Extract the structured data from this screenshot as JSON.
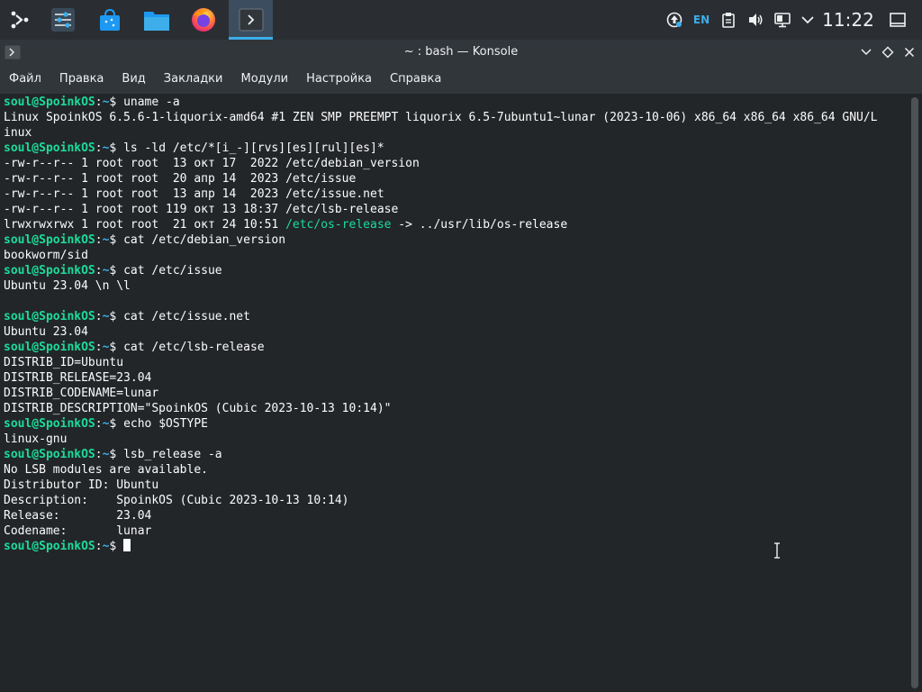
{
  "panel": {
    "launchers": [
      {
        "name": "application-launcher-icon"
      },
      {
        "name": "system-settings-icon"
      },
      {
        "name": "discover-store-icon"
      },
      {
        "name": "dolphin-file-manager-icon"
      },
      {
        "name": "firefox-icon"
      },
      {
        "name": "konsole-task-icon"
      }
    ],
    "tray": {
      "language": "EN",
      "clock": "11:22"
    }
  },
  "window": {
    "title": "~ : bash — Konsole"
  },
  "menu": [
    "Файл",
    "Правка",
    "Вид",
    "Закладки",
    "Модули",
    "Настройка",
    "Справка"
  ],
  "terminal": {
    "user_host": "soul@SpoinkOS",
    "path": "~",
    "lines": [
      {
        "type": "prompt",
        "cmd": "uname -a"
      },
      {
        "type": "out",
        "text": "Linux SpoinkOS 6.5.6-1-liquorix-amd64 #1 ZEN SMP PREEMPT liquorix 6.5-7ubuntu1~lunar (2023-10-06) x86_64 x86_64 x86_64 GNU/L"
      },
      {
        "type": "out",
        "text": "inux"
      },
      {
        "type": "prompt",
        "cmd": "ls -ld /etc/*[i_-][rvs][es][rul][es]*"
      },
      {
        "type": "out",
        "text": "-rw-r--r-- 1 root root  13 окт 17  2022 /etc/debian_version"
      },
      {
        "type": "out",
        "text": "-rw-r--r-- 1 root root  20 апр 14  2023 /etc/issue"
      },
      {
        "type": "out",
        "text": "-rw-r--r-- 1 root root  13 апр 14  2023 /etc/issue.net"
      },
      {
        "type": "out",
        "text": "-rw-r--r-- 1 root root 119 окт 13 18:37 /etc/lsb-release"
      },
      {
        "type": "link",
        "text": "lrwxrwxrwx 1 root root  21 окт 24 10:51 ",
        "link": "/etc/os-release",
        "rest": " -> ../usr/lib/os-release"
      },
      {
        "type": "prompt",
        "cmd": "cat /etc/debian_version"
      },
      {
        "type": "out",
        "text": "bookworm/sid"
      },
      {
        "type": "prompt",
        "cmd": "cat /etc/issue"
      },
      {
        "type": "out",
        "text": "Ubuntu 23.04 \\n \\l"
      },
      {
        "type": "out",
        "text": ""
      },
      {
        "type": "prompt",
        "cmd": "cat /etc/issue.net"
      },
      {
        "type": "out",
        "text": "Ubuntu 23.04"
      },
      {
        "type": "prompt",
        "cmd": "cat /etc/lsb-release"
      },
      {
        "type": "out",
        "text": "DISTRIB_ID=Ubuntu"
      },
      {
        "type": "out",
        "text": "DISTRIB_RELEASE=23.04"
      },
      {
        "type": "out",
        "text": "DISTRIB_CODENAME=lunar"
      },
      {
        "type": "out",
        "text": "DISTRIB_DESCRIPTION=\"SpoinkOS (Cubic 2023-10-13 10:14)\""
      },
      {
        "type": "prompt",
        "cmd": "echo $OSTYPE"
      },
      {
        "type": "out",
        "text": "linux-gnu"
      },
      {
        "type": "prompt",
        "cmd": "lsb_release -a"
      },
      {
        "type": "out",
        "text": "No LSB modules are available."
      },
      {
        "type": "out",
        "text": "Distributor ID: Ubuntu"
      },
      {
        "type": "out",
        "text": "Description:    SpoinkOS (Cubic 2023-10-13 10:14)"
      },
      {
        "type": "out",
        "text": "Release:        23.04"
      },
      {
        "type": "out",
        "text": "Codename:       lunar"
      },
      {
        "type": "cursor",
        "cmd": ""
      }
    ]
  },
  "colors": {
    "prompt_user": "#1cdc9a",
    "prompt_path": "#3daee9",
    "text": "#fcfcfc",
    "background": "#232629"
  }
}
